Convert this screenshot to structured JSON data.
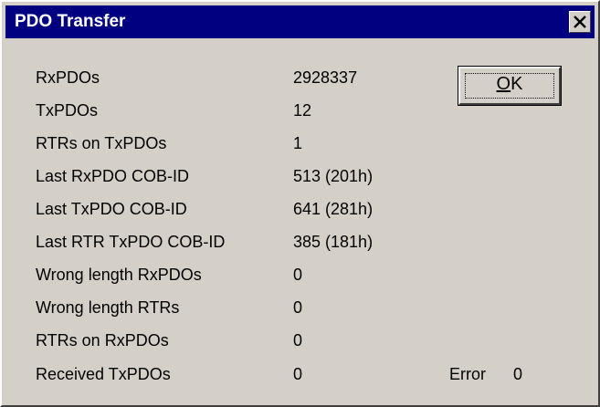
{
  "window": {
    "title": "PDO Transfer",
    "title_bar_color": "#000080",
    "background_color": "#d4d0c8"
  },
  "ok_button": {
    "mnemonic": "O",
    "rest": "K"
  },
  "stats": [
    {
      "label": "RxPDOs",
      "value": "2928337"
    },
    {
      "label": "TxPDOs",
      "value": "12"
    },
    {
      "label": "RTRs on TxPDOs",
      "value": "1"
    },
    {
      "label": "Last RxPDO COB-ID",
      "value": "513 (201h)"
    },
    {
      "label": "Last TxPDO COB-ID",
      "value": "641 (281h)"
    },
    {
      "label": "Last RTR TxPDO COB-ID",
      "value": "385 (181h)"
    },
    {
      "label": "Wrong length RxPDOs",
      "value": "0"
    },
    {
      "label": "Wrong length RTRs",
      "value": "0"
    },
    {
      "label": "RTRs on RxPDOs",
      "value": "0"
    },
    {
      "label": "Received TxPDOs",
      "value": "0"
    }
  ],
  "error": {
    "label": "Error",
    "value": "0"
  },
  "icons": {
    "close": "close-icon"
  }
}
